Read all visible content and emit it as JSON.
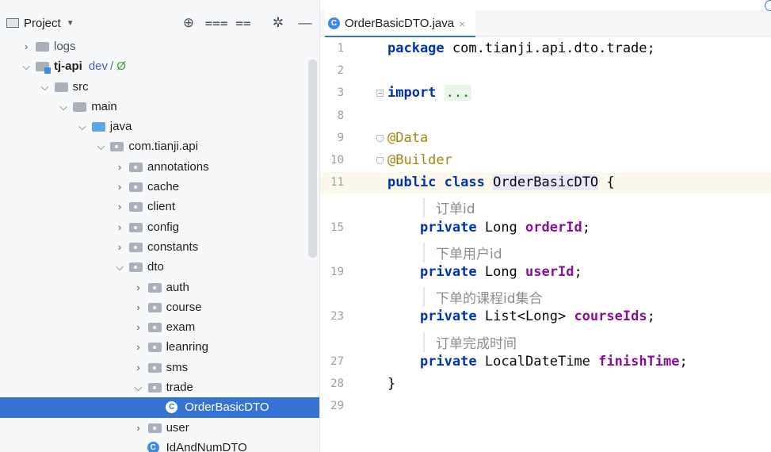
{
  "project_panel": {
    "title": "Project",
    "tools": [
      {
        "name": "locate-icon",
        "glyph": "⊕"
      },
      {
        "name": "expand-all-icon",
        "glyph": "⩶"
      },
      {
        "name": "collapse-all-icon",
        "glyph": "⩵"
      },
      {
        "name": "settings-gear-icon",
        "glyph": "✲"
      },
      {
        "name": "hide-panel-icon",
        "glyph": "—"
      }
    ],
    "tree": [
      {
        "depth": 0,
        "arrow": ">",
        "icon": "folder",
        "label": "logs",
        "muted": true
      },
      {
        "depth": 0,
        "arrow": "v",
        "icon": "module",
        "label": "tj-api",
        "bold": true,
        "branch": "dev",
        "branch_sep": "/",
        "branch_mark": "Ø"
      },
      {
        "depth": 1,
        "arrow": "v",
        "icon": "folder",
        "label": "src"
      },
      {
        "depth": 2,
        "arrow": "v",
        "icon": "folder",
        "label": "main"
      },
      {
        "depth": 3,
        "arrow": "v",
        "icon": "folder-blue",
        "label": "java"
      },
      {
        "depth": 4,
        "arrow": "v",
        "icon": "package",
        "label": "com.tianji.api"
      },
      {
        "depth": 5,
        "arrow": ">",
        "icon": "package",
        "label": "annotations"
      },
      {
        "depth": 5,
        "arrow": ">",
        "icon": "package",
        "label": "cache"
      },
      {
        "depth": 5,
        "arrow": ">",
        "icon": "package",
        "label": "client"
      },
      {
        "depth": 5,
        "arrow": ">",
        "icon": "package",
        "label": "config"
      },
      {
        "depth": 5,
        "arrow": ">",
        "icon": "package",
        "label": "constants"
      },
      {
        "depth": 5,
        "arrow": "v",
        "icon": "package",
        "label": "dto"
      },
      {
        "depth": 6,
        "arrow": ">",
        "icon": "package",
        "label": "auth"
      },
      {
        "depth": 6,
        "arrow": ">",
        "icon": "package",
        "label": "course"
      },
      {
        "depth": 6,
        "arrow": ">",
        "icon": "package",
        "label": "exam"
      },
      {
        "depth": 6,
        "arrow": ">",
        "icon": "package",
        "label": "leanring"
      },
      {
        "depth": 6,
        "arrow": ">",
        "icon": "package",
        "label": "sms"
      },
      {
        "depth": 6,
        "arrow": "v",
        "icon": "package",
        "label": "trade"
      },
      {
        "depth": 7,
        "arrow": "",
        "icon": "class",
        "label": "OrderBasicDTO",
        "selected": true
      },
      {
        "depth": 6,
        "arrow": ">",
        "icon": "package",
        "label": "user"
      },
      {
        "depth": 6,
        "arrow": "",
        "icon": "class",
        "label": "IdAndNumDTO"
      }
    ]
  },
  "editor": {
    "tab": {
      "icon": "C",
      "label": "OrderBasicDTO.java",
      "close": "×"
    },
    "lines": [
      {
        "no": "1",
        "kind": "code",
        "tokens": [
          {
            "t": "package",
            "c": "kw"
          },
          {
            "t": " com.tianji.api.dto.trade;"
          }
        ]
      },
      {
        "no": "2",
        "kind": "code",
        "tokens": []
      },
      {
        "no": "3",
        "kind": "code",
        "fold": "plus",
        "tokens": [
          {
            "t": "import",
            "c": "kw"
          },
          {
            "t": " "
          },
          {
            "t": "...",
            "c": "fold-dots"
          }
        ]
      },
      {
        "no": "8",
        "kind": "code",
        "tokens": []
      },
      {
        "no": "9",
        "kind": "code",
        "fold": "round",
        "tokens": [
          {
            "t": "@Data",
            "c": "ann"
          }
        ]
      },
      {
        "no": "10",
        "kind": "code",
        "fold": "round",
        "tokens": [
          {
            "t": "@Builder",
            "c": "ann"
          }
        ]
      },
      {
        "no": "11",
        "kind": "code",
        "current": true,
        "tokens": [
          {
            "t": "public",
            "c": "kw"
          },
          {
            "t": " "
          },
          {
            "t": "class",
            "c": "kw"
          },
          {
            "t": " "
          },
          {
            "t": "OrderBasicDTO",
            "c": "cls-hl"
          },
          {
            "t": " {"
          }
        ]
      },
      {
        "no": "",
        "kind": "doc",
        "text": "订单id"
      },
      {
        "no": "15",
        "kind": "code",
        "tokens": [
          {
            "t": "    "
          },
          {
            "t": "private",
            "c": "kw"
          },
          {
            "t": " Long "
          },
          {
            "t": "orderId",
            "c": "fld"
          },
          {
            "t": ";"
          }
        ]
      },
      {
        "no": "",
        "kind": "doc",
        "text": "下单用户id"
      },
      {
        "no": "19",
        "kind": "code",
        "tokens": [
          {
            "t": "    "
          },
          {
            "t": "private",
            "c": "kw"
          },
          {
            "t": " Long "
          },
          {
            "t": "userId",
            "c": "fld"
          },
          {
            "t": ";"
          }
        ]
      },
      {
        "no": "",
        "kind": "doc",
        "text": "下单的课程id集合"
      },
      {
        "no": "23",
        "kind": "code",
        "tokens": [
          {
            "t": "    "
          },
          {
            "t": "private",
            "c": "kw"
          },
          {
            "t": " List<Long> "
          },
          {
            "t": "courseIds",
            "c": "fld"
          },
          {
            "t": ";"
          }
        ]
      },
      {
        "no": "",
        "kind": "doc",
        "text": "订单完成时间"
      },
      {
        "no": "27",
        "kind": "code",
        "tokens": [
          {
            "t": "    "
          },
          {
            "t": "private",
            "c": "kw"
          },
          {
            "t": " LocalDateTime "
          },
          {
            "t": "finishTime",
            "c": "fld"
          },
          {
            "t": ";"
          }
        ]
      },
      {
        "no": "28",
        "kind": "code",
        "tokens": [
          {
            "t": "}"
          }
        ]
      },
      {
        "no": "29",
        "kind": "code",
        "tokens": []
      }
    ]
  },
  "colors": {
    "selection": "#3574d4",
    "keyword": "#0033b3",
    "annotation": "#9e880d",
    "field": "#871094",
    "current_line": "#fcf9ea"
  }
}
